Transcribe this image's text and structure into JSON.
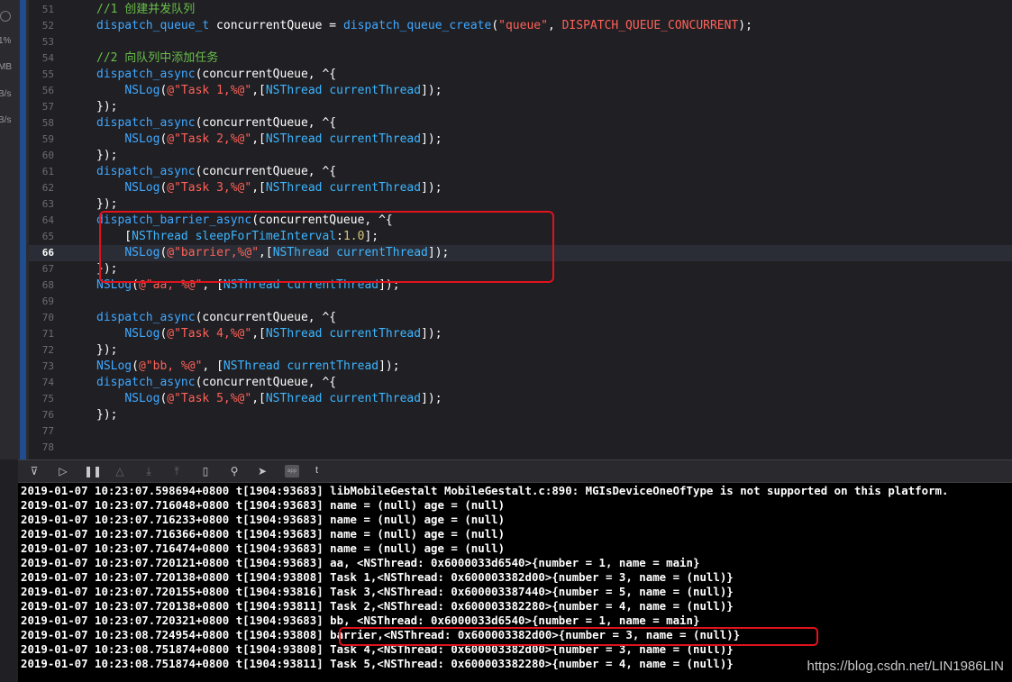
{
  "nav_strip": {
    "labels": [
      "1%",
      "MB",
      "B/s",
      "B/s"
    ]
  },
  "editor": {
    "active_line": "66",
    "lines": [
      {
        "num": "51",
        "parts": [
          [
            "cm",
            "//1 创建并发队列"
          ]
        ]
      },
      {
        "num": "52",
        "parts": [
          [
            "fn",
            "dispatch_queue_t"
          ],
          [
            "plain",
            " concurrentQueue = "
          ],
          [
            "fn",
            "dispatch_queue_create"
          ],
          [
            "plain",
            "("
          ],
          [
            "str",
            "\"queue\""
          ],
          [
            "plain",
            ", "
          ],
          [
            "const",
            "DISPATCH_QUEUE_CONCURRENT"
          ],
          [
            "plain",
            ");"
          ]
        ]
      },
      {
        "num": "53",
        "parts": []
      },
      {
        "num": "54",
        "parts": [
          [
            "cm",
            "//2 向队列中添加任务"
          ]
        ]
      },
      {
        "num": "55",
        "parts": [
          [
            "fn",
            "dispatch_async"
          ],
          [
            "plain",
            "(concurrentQueue, ^{"
          ]
        ]
      },
      {
        "num": "56",
        "parts": [
          [
            "plain",
            "    "
          ],
          [
            "fn",
            "NSLog"
          ],
          [
            "plain",
            "("
          ],
          [
            "str",
            "@\"Task 1,%@\""
          ],
          [
            "plain",
            ",["
          ],
          [
            "cls",
            "NSThread"
          ],
          [
            "plain",
            " "
          ],
          [
            "cls",
            "currentThread"
          ],
          [
            "plain",
            "]);"
          ]
        ]
      },
      {
        "num": "57",
        "parts": [
          [
            "plain",
            "});"
          ]
        ]
      },
      {
        "num": "58",
        "parts": [
          [
            "fn",
            "dispatch_async"
          ],
          [
            "plain",
            "(concurrentQueue, ^{"
          ]
        ]
      },
      {
        "num": "59",
        "parts": [
          [
            "plain",
            "    "
          ],
          [
            "fn",
            "NSLog"
          ],
          [
            "plain",
            "("
          ],
          [
            "str",
            "@\"Task 2,%@\""
          ],
          [
            "plain",
            ",["
          ],
          [
            "cls",
            "NSThread"
          ],
          [
            "plain",
            " "
          ],
          [
            "cls",
            "currentThread"
          ],
          [
            "plain",
            "]);"
          ]
        ]
      },
      {
        "num": "60",
        "parts": [
          [
            "plain",
            "});"
          ]
        ]
      },
      {
        "num": "61",
        "parts": [
          [
            "fn",
            "dispatch_async"
          ],
          [
            "plain",
            "(concurrentQueue, ^{"
          ]
        ]
      },
      {
        "num": "62",
        "parts": [
          [
            "plain",
            "    "
          ],
          [
            "fn",
            "NSLog"
          ],
          [
            "plain",
            "("
          ],
          [
            "str",
            "@\"Task 3,%@\""
          ],
          [
            "plain",
            ",["
          ],
          [
            "cls",
            "NSThread"
          ],
          [
            "plain",
            " "
          ],
          [
            "cls",
            "currentThread"
          ],
          [
            "plain",
            "]);"
          ]
        ]
      },
      {
        "num": "63",
        "parts": [
          [
            "plain",
            "});"
          ]
        ]
      },
      {
        "num": "64",
        "parts": [
          [
            "fn",
            "dispatch_barrier_async"
          ],
          [
            "plain",
            "(concurrentQueue, ^{"
          ]
        ]
      },
      {
        "num": "65",
        "parts": [
          [
            "plain",
            "    ["
          ],
          [
            "cls",
            "NSThread"
          ],
          [
            "plain",
            " "
          ],
          [
            "cls",
            "sleepForTimeInterval"
          ],
          [
            "plain",
            ":"
          ],
          [
            "num",
            "1.0"
          ],
          [
            "plain",
            "];"
          ]
        ]
      },
      {
        "num": "66",
        "parts": [
          [
            "plain",
            "    "
          ],
          [
            "fn",
            "NSLog"
          ],
          [
            "plain",
            "("
          ],
          [
            "str",
            "@\"barrier,%@\""
          ],
          [
            "plain",
            ",["
          ],
          [
            "cls",
            "NSThread"
          ],
          [
            "plain",
            " "
          ],
          [
            "cls",
            "currentThread"
          ],
          [
            "plain",
            "]);"
          ]
        ]
      },
      {
        "num": "67",
        "parts": [
          [
            "plain",
            "});"
          ]
        ]
      },
      {
        "num": "68",
        "parts": [
          [
            "fn",
            "NSLog"
          ],
          [
            "plain",
            "("
          ],
          [
            "str",
            "@\"aa, %@\""
          ],
          [
            "plain",
            ", ["
          ],
          [
            "cls",
            "NSThread"
          ],
          [
            "plain",
            " "
          ],
          [
            "cls",
            "currentThread"
          ],
          [
            "plain",
            "]);"
          ]
        ]
      },
      {
        "num": "69",
        "parts": []
      },
      {
        "num": "70",
        "parts": [
          [
            "fn",
            "dispatch_async"
          ],
          [
            "plain",
            "(concurrentQueue, ^{"
          ]
        ]
      },
      {
        "num": "71",
        "parts": [
          [
            "plain",
            "    "
          ],
          [
            "fn",
            "NSLog"
          ],
          [
            "plain",
            "("
          ],
          [
            "str",
            "@\"Task 4,%@\""
          ],
          [
            "plain",
            ",["
          ],
          [
            "cls",
            "NSThread"
          ],
          [
            "plain",
            " "
          ],
          [
            "cls",
            "currentThread"
          ],
          [
            "plain",
            "]);"
          ]
        ]
      },
      {
        "num": "72",
        "parts": [
          [
            "plain",
            "});"
          ]
        ]
      },
      {
        "num": "73",
        "parts": [
          [
            "fn",
            "NSLog"
          ],
          [
            "plain",
            "("
          ],
          [
            "str",
            "@\"bb, %@\""
          ],
          [
            "plain",
            ", ["
          ],
          [
            "cls",
            "NSThread"
          ],
          [
            "plain",
            " "
          ],
          [
            "cls",
            "currentThread"
          ],
          [
            "plain",
            "]);"
          ]
        ]
      },
      {
        "num": "74",
        "parts": [
          [
            "fn",
            "dispatch_async"
          ],
          [
            "plain",
            "(concurrentQueue, ^{"
          ]
        ]
      },
      {
        "num": "75",
        "parts": [
          [
            "plain",
            "    "
          ],
          [
            "fn",
            "NSLog"
          ],
          [
            "plain",
            "("
          ],
          [
            "str",
            "@\"Task 5,%@\""
          ],
          [
            "plain",
            ",["
          ],
          [
            "cls",
            "NSThread"
          ],
          [
            "plain",
            " "
          ],
          [
            "cls",
            "currentThread"
          ],
          [
            "plain",
            "]);"
          ]
        ]
      },
      {
        "num": "76",
        "parts": [
          [
            "plain",
            "});"
          ]
        ]
      },
      {
        "num": "77",
        "parts": []
      },
      {
        "num": "78",
        "parts": []
      }
    ]
  },
  "debug_bar": {
    "thread_label": "t"
  },
  "console": {
    "lines": [
      "2019-01-07 10:23:07.598694+0800 t[1904:93683] libMobileGestalt MobileGestalt.c:890: MGIsDeviceOneOfType is not supported on this platform.",
      "2019-01-07 10:23:07.716048+0800 t[1904:93683] name = (null) age = (null)",
      "2019-01-07 10:23:07.716233+0800 t[1904:93683] name = (null) age = (null)",
      "2019-01-07 10:23:07.716366+0800 t[1904:93683] name = (null) age = (null)",
      "2019-01-07 10:23:07.716474+0800 t[1904:93683] name = (null) age = (null)",
      "2019-01-07 10:23:07.720121+0800 t[1904:93683] aa, <NSThread: 0x6000033d6540>{number = 1, name = main}",
      "2019-01-07 10:23:07.720138+0800 t[1904:93808] Task 1,<NSThread: 0x600003382d00>{number = 3, name = (null)}",
      "2019-01-07 10:23:07.720155+0800 t[1904:93816] Task 3,<NSThread: 0x600003387440>{number = 5, name = (null)}",
      "2019-01-07 10:23:07.720138+0800 t[1904:93811] Task 2,<NSThread: 0x600003382280>{number = 4, name = (null)}",
      "2019-01-07 10:23:07.720321+0800 t[1904:93683] bb, <NSThread: 0x6000033d6540>{number = 1, name = main}",
      "2019-01-07 10:23:08.724954+0800 t[1904:93808] barrier,<NSThread: 0x600003382d00>{number = 3, name = (null)}",
      "2019-01-07 10:23:08.751874+0800 t[1904:93808] Task 4,<NSThread: 0x600003382d00>{number = 3, name = (null)}",
      "2019-01-07 10:23:08.751874+0800 t[1904:93811] Task 5,<NSThread: 0x600003382280>{number = 4, name = (null)}"
    ]
  },
  "watermark": "https://blog.csdn.net/LIN1986LIN",
  "colors": {
    "comment": "#6bbf4a",
    "function": "#40a8ff",
    "string": "#ff6258",
    "class": "#3db6ff",
    "highlight_box": "#e0121c"
  }
}
